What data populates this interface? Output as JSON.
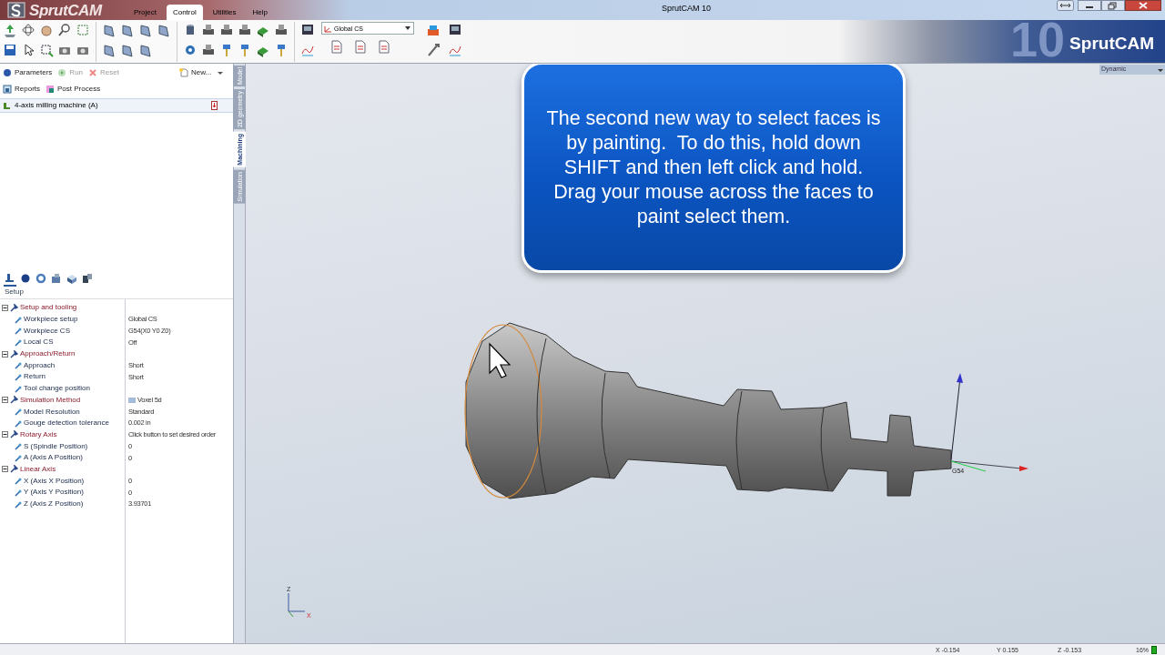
{
  "window": {
    "title": "SprutCAM 10",
    "logo": "SprutCAM",
    "banner": "SprutCAM",
    "banner_version": "10"
  },
  "menu_tabs": [
    {
      "label": "Project",
      "selected": false
    },
    {
      "label": "Control",
      "selected": true
    },
    {
      "label": "Utilities",
      "selected": false
    },
    {
      "label": "Help",
      "selected": false
    }
  ],
  "toolbar": {
    "cs_dropdown": "Global CS"
  },
  "operations": [
    {
      "label": "Parameters",
      "disabled": false
    },
    {
      "label": "Run",
      "disabled": true
    },
    {
      "label": "Reset",
      "disabled": true
    },
    {
      "label": "New...",
      "disabled": false
    }
  ],
  "outputs": [
    {
      "label": "Reports"
    },
    {
      "label": "Post Process"
    }
  ],
  "machine": {
    "label": "4-axis milling machine (A)"
  },
  "side_tabs": [
    {
      "label": "Model",
      "selected": false
    },
    {
      "label": "2D geometry",
      "selected": false
    },
    {
      "label": "Machining",
      "selected": true
    },
    {
      "label": "Simulation",
      "selected": false
    }
  ],
  "panel_tabs": [
    {
      "selected": true
    },
    {
      "selected": false
    },
    {
      "selected": false
    },
    {
      "selected": false
    },
    {
      "selected": false
    },
    {
      "selected": false
    }
  ],
  "panel_title": "Setup",
  "properties": [
    {
      "label": "Setup and tooling",
      "expanded": true,
      "children": [
        {
          "label": "Workpiece setup",
          "value": "Global CS"
        },
        {
          "label": "Workpiece CS",
          "value": "G54(X0 Y0 Z0)"
        },
        {
          "label": "Local CS",
          "value": "Off"
        }
      ]
    },
    {
      "label": "Approach/Return",
      "expanded": true,
      "children": [
        {
          "label": "Approach",
          "value": "Short"
        },
        {
          "label": "Return",
          "value": "Short"
        },
        {
          "label": "Tool change position"
        }
      ]
    },
    {
      "label": "Simulation Method",
      "value": "Voxel 5d",
      "expanded": true,
      "children": [
        {
          "label": "Model Resolution",
          "value": "Standard"
        },
        {
          "label": "Gouge detection tolerance",
          "value": "0.002 in"
        }
      ]
    },
    {
      "label": "Rotary Axis",
      "value": "Click button to set desired order",
      "expanded": true,
      "children": [
        {
          "label": "S (Spindle Position)",
          "value": "0"
        },
        {
          "label": "A (Axis A Position)",
          "value": "0"
        }
      ]
    },
    {
      "label": "Linear Axis",
      "expanded": true,
      "children": [
        {
          "label": "X (Axis X Position)",
          "value": "0"
        },
        {
          "label": "Y (Axis Y Position)",
          "value": "0"
        },
        {
          "label": "Z (Axis Z Position)",
          "value": "3.93701"
        }
      ]
    }
  ],
  "viewport": {
    "view_mode": "Dynamic",
    "callout": "The second new way to select faces is by painting.  To do this, hold down SHIFT and then left click and hold.  Drag your mouse across the faces to paint select them.",
    "cs_label": "G54",
    "triad_z": "Z",
    "triad_x": "X"
  },
  "status_bar": {
    "x": "X -0.154",
    "y": "Y 0.155",
    "z": "Z -0.153",
    "zoom": "16%"
  }
}
